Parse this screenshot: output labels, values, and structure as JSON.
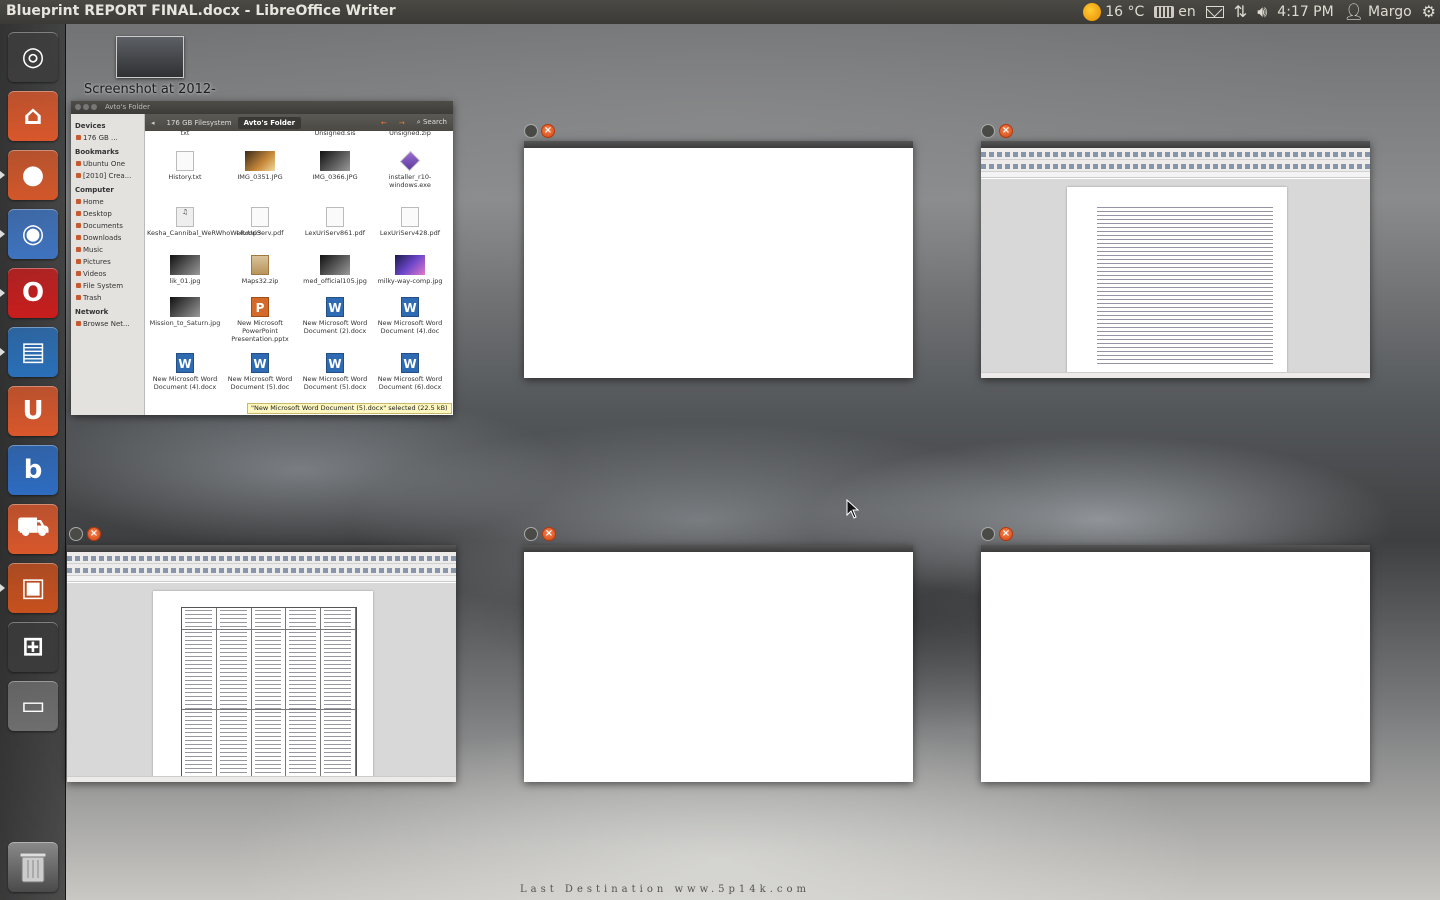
{
  "panel": {
    "window_title": "Blueprint REPORT FINAL.docx - LibreOffice Writer",
    "weather": "16 °C",
    "keyboard": "en",
    "clock": "4:17 PM",
    "user": "Margo"
  },
  "launcher": {
    "items": [
      {
        "name": "dash-home-icon",
        "bg": "#3d3d3d"
      },
      {
        "name": "home-folder-icon",
        "bg": "#d9572b"
      },
      {
        "name": "firefox-icon",
        "bg": "#d2572a"
      },
      {
        "name": "chromium-icon",
        "bg": "#3e73bf"
      },
      {
        "name": "opera-icon",
        "bg": "#c81d1d"
      },
      {
        "name": "libreoffice-writer-icon",
        "bg": "#2a6fb8"
      },
      {
        "name": "ubuntu-one-icon",
        "bg": "#d9572b"
      },
      {
        "name": "bible-app-icon",
        "bg": "#2e6cc1"
      },
      {
        "name": "software-center-icon",
        "bg": "#d9572b"
      },
      {
        "name": "libreoffice-impress-icon",
        "bg": "#c7501e"
      },
      {
        "name": "workspace-switcher-icon",
        "bg": "#3b3b3b"
      },
      {
        "name": "drive-icon",
        "bg": "#6e6e6e"
      }
    ],
    "trash": "trash-icon"
  },
  "desktop": {
    "screenshot_label": "Screenshot at 2012-"
  },
  "nautilus": {
    "title": "Avto's Folder",
    "breadcrumbs": [
      "176 GB Filesystem",
      "Avto's Folder"
    ],
    "search": "Search",
    "sidebar": {
      "devices_head": "Devices",
      "devices": [
        "176 GB ..."
      ],
      "bookmarks_head": "Bookmarks",
      "bookmarks": [
        "Ubuntu One",
        "[2010] Crea..."
      ],
      "computer_head": "Computer",
      "computer": [
        "Home",
        "Desktop",
        "Documents",
        "Downloads",
        "Music",
        "Pictures",
        "Videos",
        "File System",
        "Trash"
      ],
      "network_head": "Network",
      "network": [
        "Browse Net..."
      ]
    },
    "files": [
      {
        "label": "txt",
        "icon": "plain"
      },
      {
        "label": "",
        "icon": "none"
      },
      {
        "label": "Unsigned.sis",
        "icon": "none"
      },
      {
        "label": "Unsigned.zip",
        "icon": "none"
      },
      {
        "label": "History.txt",
        "icon": "plain"
      },
      {
        "label": "IMG_0351.JPG",
        "icon": "img"
      },
      {
        "label": "IMG_0366.JPG",
        "icon": "img2"
      },
      {
        "label": "installer_r10-windows.exe",
        "icon": "exe"
      },
      {
        "label": "Kesha_Cannibal_WeRWhoWeR.mp3",
        "icon": "mp3"
      },
      {
        "label": "LexUriServ.pdf",
        "icon": "plain"
      },
      {
        "label": "LexUriServ861.pdf",
        "icon": "plain"
      },
      {
        "label": "LexUriServ428.pdf",
        "icon": "plain"
      },
      {
        "label": "lik_01.jpg",
        "icon": "img2"
      },
      {
        "label": "Maps32.zip",
        "icon": "zip"
      },
      {
        "label": "med_official105.jpg",
        "icon": "img2"
      },
      {
        "label": "milky-way-comp.jpg",
        "icon": "img3"
      },
      {
        "label": "Mission_to_Saturn.jpg",
        "icon": "img2"
      },
      {
        "label": "New Microsoft PowerPoint Presentation.pptx",
        "icon": "ppt"
      },
      {
        "label": "New Microsoft Word Document (2).docx",
        "icon": "doc"
      },
      {
        "label": "New Microsoft Word Document (4).doc",
        "icon": "doc"
      },
      {
        "label": "New Microsoft Word Document (4).docx",
        "icon": "doc"
      },
      {
        "label": "New Microsoft Word Document (5).doc",
        "icon": "doc"
      },
      {
        "label": "New Microsoft Word Document (5).docx",
        "icon": "doc"
      },
      {
        "label": "New Microsoft Word Document (6).docx",
        "icon": "doc"
      }
    ],
    "status": "\"New Microsoft Word Document (5).docx\" selected (22.5 kB)"
  },
  "wallpaper": {
    "credit": "Last Destination www.5p14k.com"
  }
}
